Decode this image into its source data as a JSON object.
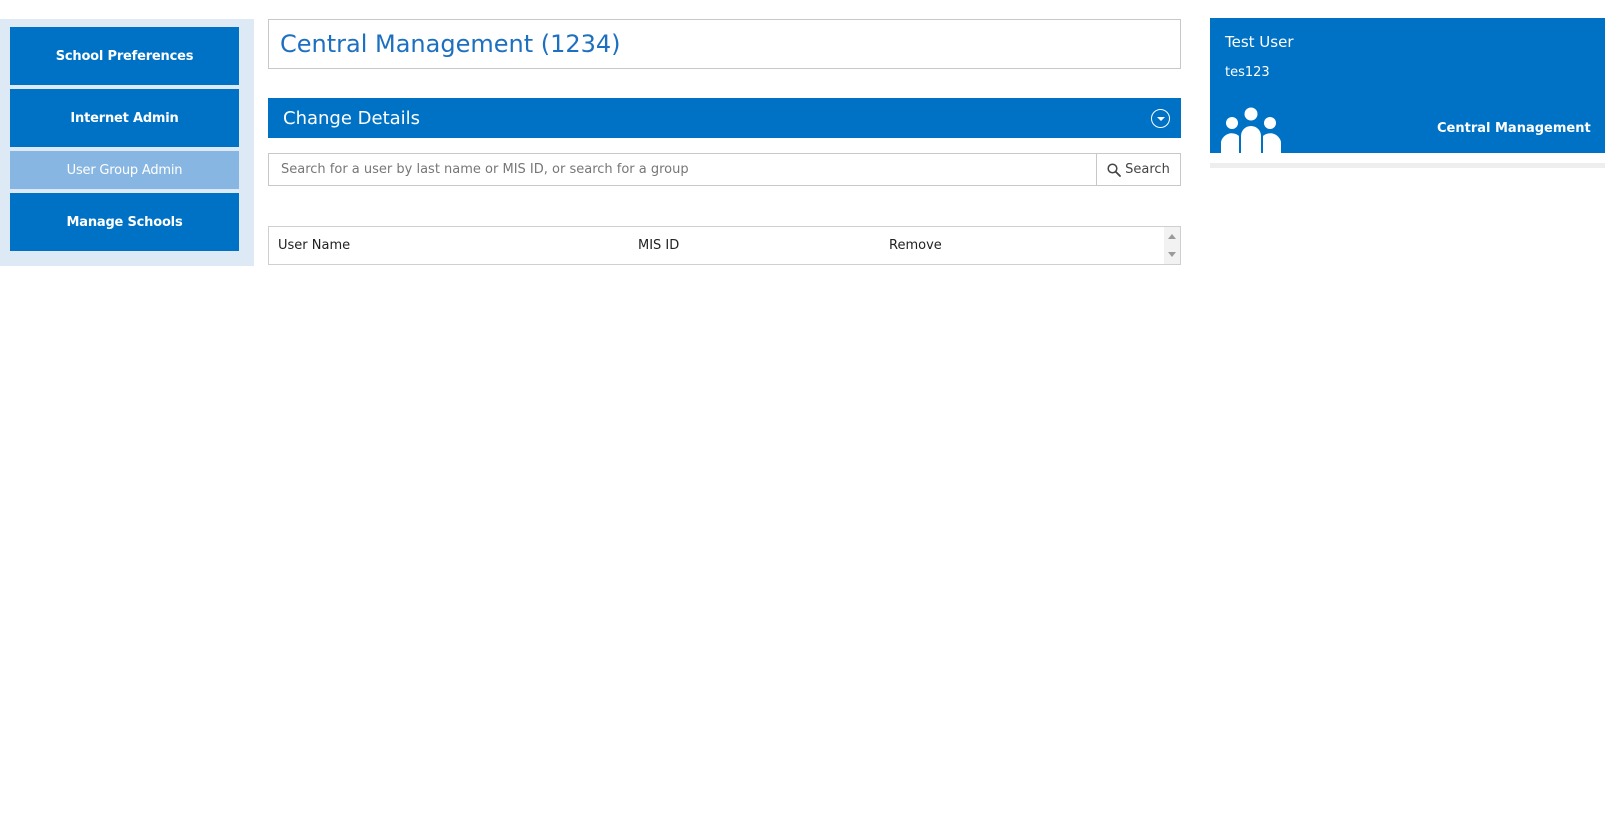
{
  "sidebar": {
    "items": [
      {
        "label": "School Preferences",
        "active": false
      },
      {
        "label": "Internet Admin",
        "active": false
      },
      {
        "label": "User Group Admin",
        "active": true
      },
      {
        "label": "Manage Schools",
        "active": false
      }
    ]
  },
  "page": {
    "title": "Central Management (1234)"
  },
  "section": {
    "title": "Change Details",
    "icon": "chevron-down-circle-icon"
  },
  "search": {
    "placeholder": "Search for a user by last name or MIS ID, or search for a group",
    "value": "",
    "button_label": "Search",
    "icon": "search-icon"
  },
  "table": {
    "columns": [
      "User Name",
      "MIS ID",
      "Remove"
    ],
    "rows": []
  },
  "user_card": {
    "name": "Test User",
    "id": "tes123",
    "organisation": "Central Management",
    "icon": "group-icon"
  },
  "colors": {
    "primary": "#0072c6",
    "active_nav": "#87b6e2",
    "sidebar_bg": "#dde9f4",
    "title_text": "#1d6fc0"
  }
}
